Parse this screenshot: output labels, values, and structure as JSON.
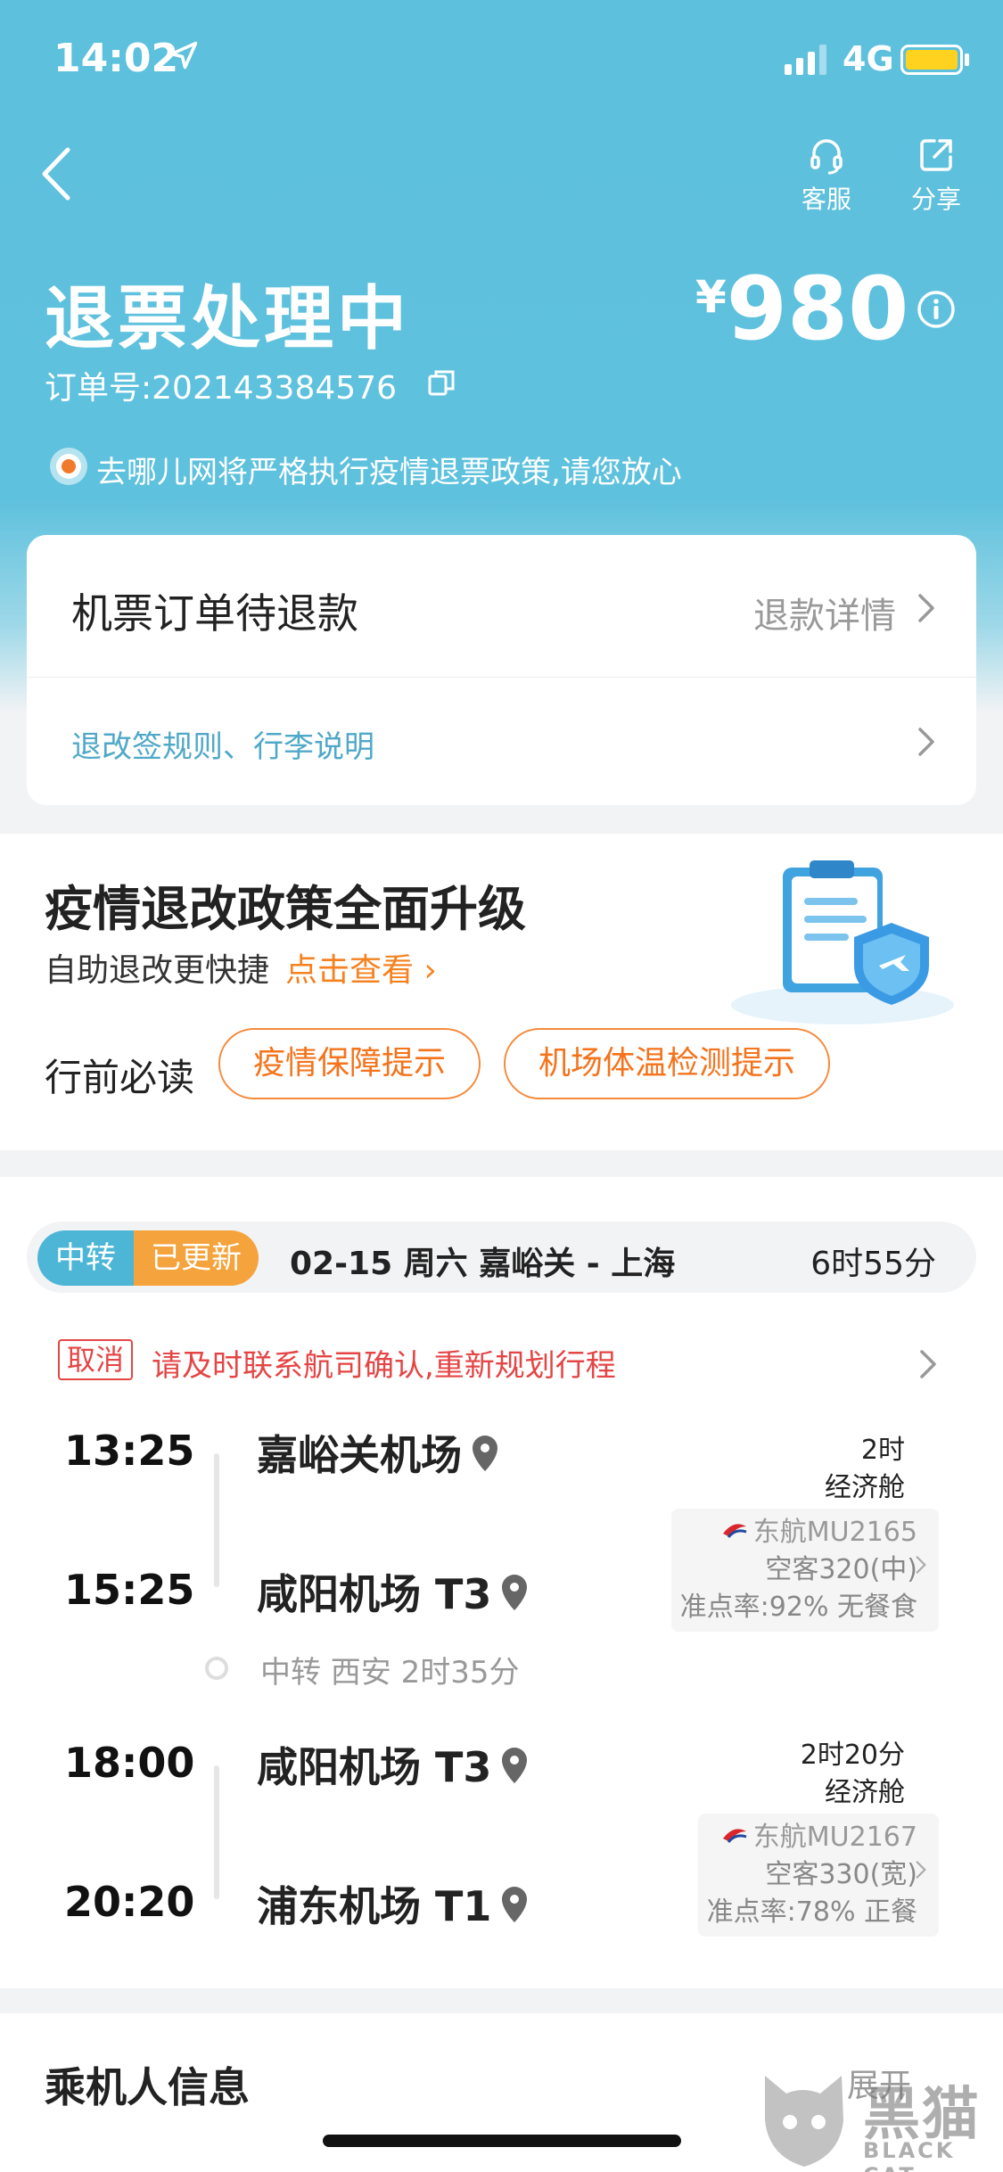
{
  "status_bar": {
    "time": "14:02",
    "network": "4G"
  },
  "header": {
    "actions": [
      {
        "label": "客服",
        "icon": "headset-icon"
      },
      {
        "label": "分享",
        "icon": "share-icon"
      }
    ],
    "title": "退票处理中",
    "order_no": "订单号:202143384576",
    "price_currency": "¥",
    "price_amount": "980",
    "notice": "去哪儿网将严格执行疫情退票政策,请您放心"
  },
  "refund_card": {
    "title": "机票订单待退款",
    "detail_link": "退款详情",
    "rules_link": "退改签规则、行李说明"
  },
  "policy": {
    "title": "疫情退改政策全面升级",
    "subtitle": "自助退改更快捷",
    "cta": "点击查看",
    "must_read": "行前必读",
    "pills": [
      "疫情保障提示",
      "机场体温检测提示"
    ]
  },
  "itinerary": {
    "tags": [
      "中转",
      "已更新"
    ],
    "route": "02-15  周六  嘉峪关 - 上海",
    "total_duration": "6时55分",
    "cancel_tag": "取消",
    "cancel_msg": "请及时联系航司确认,重新规划行程",
    "segments": [
      {
        "dep_time": "13:25",
        "dep_airport": "嘉峪关机场",
        "arr_time": "15:25",
        "arr_airport": "咸阳机场 T3",
        "duration": "2时",
        "cabin": "经济舱",
        "airline_flight": "东航MU2165",
        "aircraft": "空客320(中)",
        "punctuality_meal": "准点率:92% 无餐食"
      },
      {
        "dep_time": "18:00",
        "dep_airport": "咸阳机场 T3",
        "arr_time": "20:20",
        "arr_airport": "浦东机场 T1",
        "duration": "2时20分",
        "cabin": "经济舱",
        "airline_flight": "东航MU2167",
        "aircraft": "空客330(宽)",
        "punctuality_meal": "准点率:78% 正餐"
      }
    ],
    "transfer": "中转 西安 2时35分"
  },
  "passenger": {
    "title": "乘机人信息",
    "expand": "展开"
  },
  "watermark": {
    "text": "黑猫",
    "sub": "BLACK CAT"
  },
  "colors": {
    "header": "#5ec1dd",
    "accent_orange": "#f58220",
    "cancel_red": "#e54545",
    "link_blue": "#4fa8c8"
  }
}
